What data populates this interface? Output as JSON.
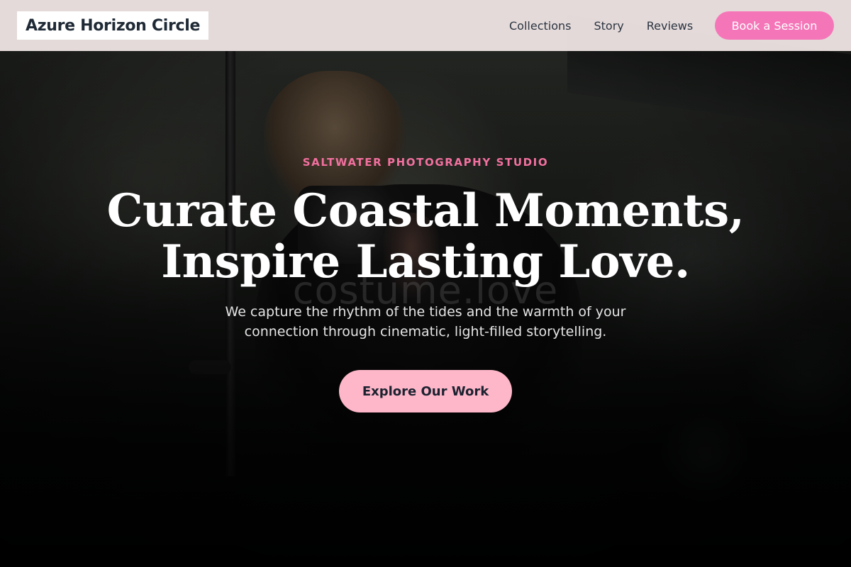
{
  "header": {
    "brand": "Azure Horizon Circle",
    "nav": [
      {
        "label": "Collections"
      },
      {
        "label": "Story"
      },
      {
        "label": "Reviews"
      }
    ],
    "cta_label": "Book a Session"
  },
  "hero": {
    "eyebrow": "SALTWATER PHOTOGRAPHY STUDIO",
    "headline_line1": "Curate Coastal Moments,",
    "headline_line2": "Inspire Lasting Love.",
    "watermark": "costume.love",
    "subtext": "We capture the rhythm of the tides and the warmth of your connection through cinematic, light-filled storytelling.",
    "cta_label": "Explore Our Work"
  },
  "colors": {
    "accent_pink": "#f576b8",
    "cta_pink": "#fdb7c9",
    "eyebrow_pink": "#f2709f",
    "header_bg": "#ece2e2",
    "brand_text": "#1f2a36"
  }
}
